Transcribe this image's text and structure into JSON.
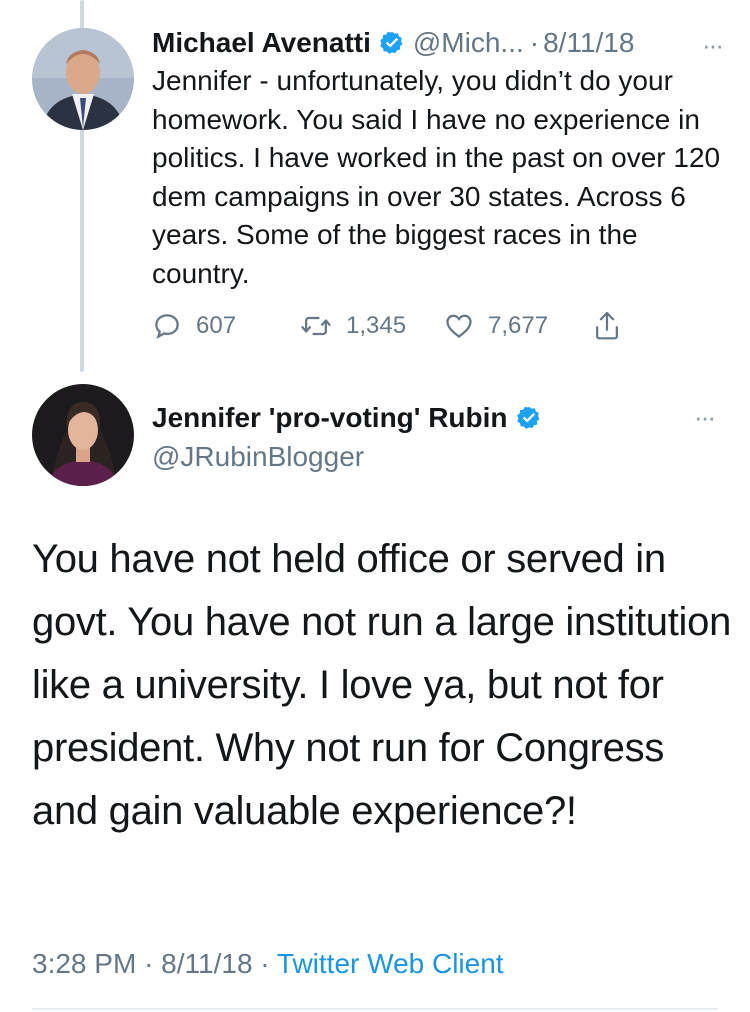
{
  "reply_tweet": {
    "author_name": "Michael Avenatti",
    "handle": "@Mich...",
    "separator": "·",
    "date": "8/11/18",
    "more": "···",
    "text": "Jennifer - unfortunately, you didn’t do your homework. You said I have no experience in politics. I have worked in the past on over 120 dem campaigns in over 30 states. Across 6 years. Some of the biggest races in the country.",
    "reply_count": "607",
    "retweet_count": "1,345",
    "like_count": "7,677"
  },
  "main_tweet": {
    "author_name": "Jennifer 'pro-voting' Rubin",
    "handle": "@JRubinBlogger",
    "more": "···",
    "text": "You have not held office or served in govt. You have not run a large institution like a university. I love ya, but not for president. Why not run for Congress and gain valuable experience?!",
    "time": "3:28 PM",
    "separator": "·",
    "date": "8/11/18",
    "client": "Twitter Web Client"
  },
  "colors": {
    "verified_badge": "#1da1f2",
    "link": "#1b95e0",
    "secondary_text": "#657786",
    "thread_line": "#cfd9de"
  },
  "icons": [
    "verified-badge-icon",
    "more-options-icon",
    "reply-icon",
    "retweet-icon",
    "like-icon",
    "share-icon"
  ]
}
